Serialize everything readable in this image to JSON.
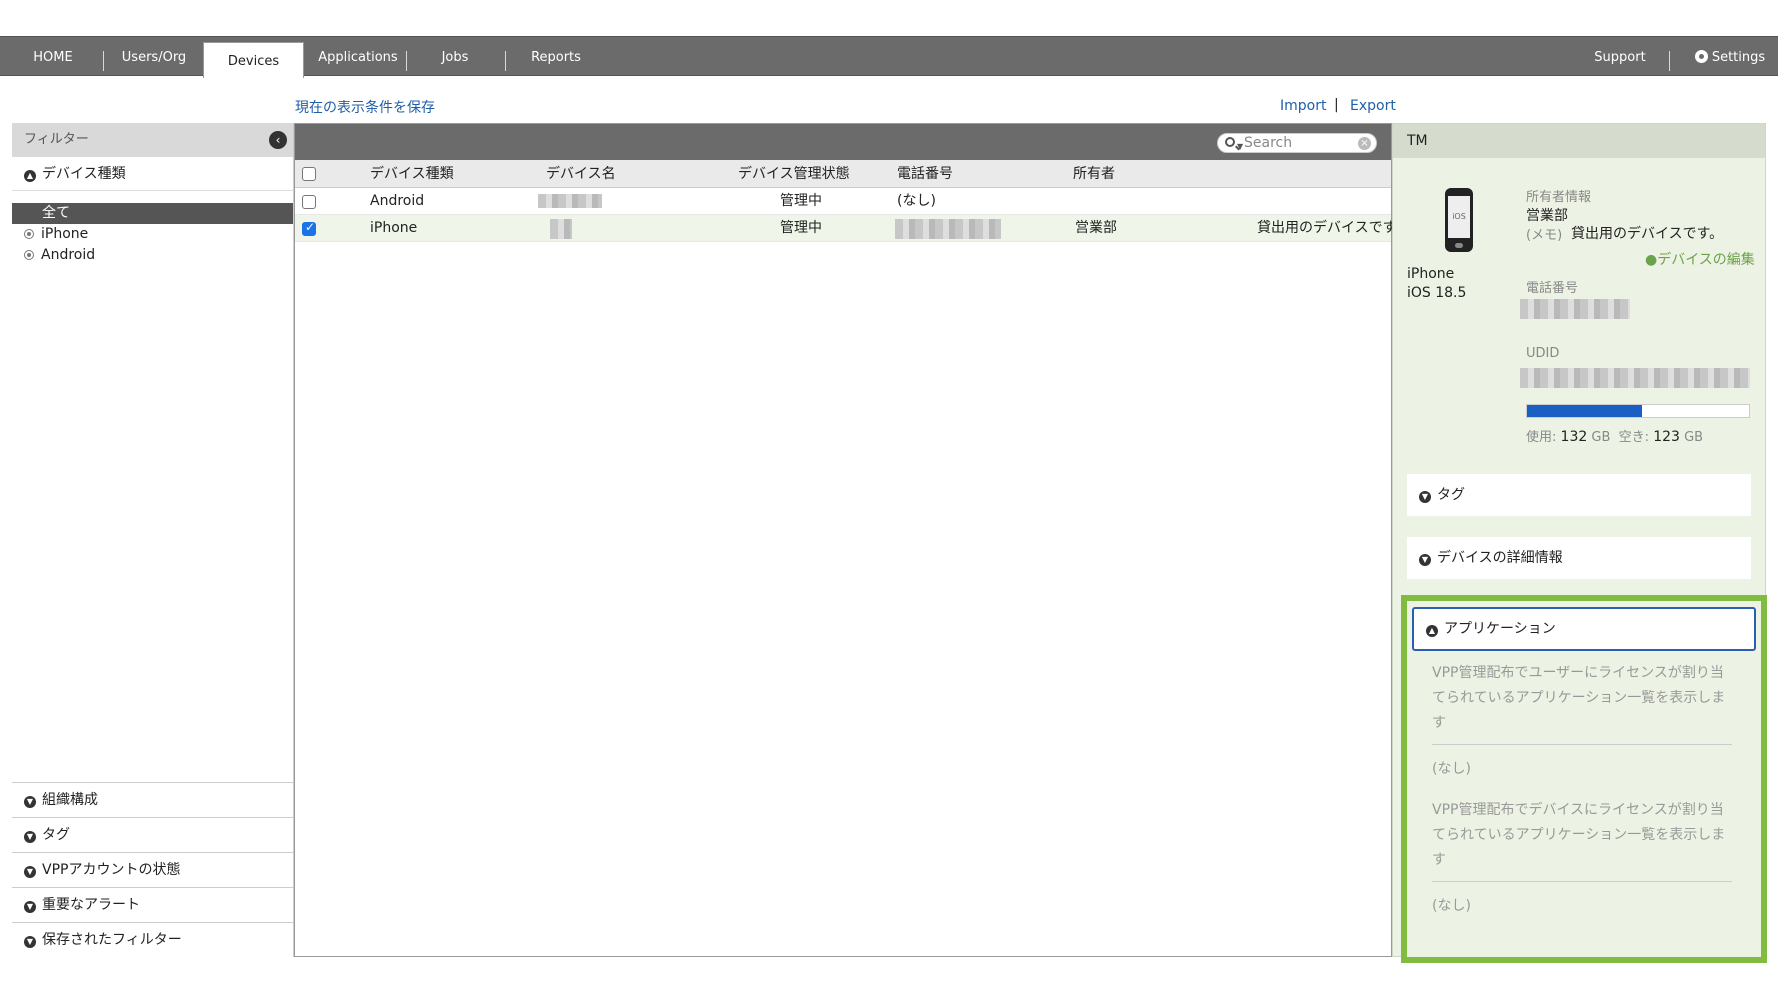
{
  "nav": {
    "items": [
      "HOME",
      "Users/Org",
      "Devices",
      "Applications",
      "Jobs",
      "Reports"
    ],
    "support": "Support",
    "settings": "Settings"
  },
  "links": {
    "save_view": "現在の表示条件を保存",
    "import": "Import",
    "separator": "|",
    "export": "Export"
  },
  "sidebar": {
    "header": "フィルター",
    "device_type_title": "デバイス種類",
    "options": [
      "全て",
      "iPhone",
      "Android"
    ],
    "bottom_sections": [
      "組織構成",
      "タグ",
      "VPPアカウントの状態",
      "重要なアラート",
      "保存されたフィルター"
    ]
  },
  "table": {
    "search_placeholder": "Search",
    "columns": [
      "デバイス種類",
      "デバイス名",
      "デバイス管理状態",
      "電話番号",
      "所有者"
    ],
    "rows": [
      {
        "type": "Android",
        "status": "管理中",
        "phone": "(なし)",
        "owner": "",
        "memo": "",
        "checked": false
      },
      {
        "type": "iPhone",
        "status": "管理中",
        "phone": "",
        "owner": "営業部",
        "memo": "貸出用のデバイスです",
        "checked": true
      }
    ]
  },
  "detail": {
    "header": "TM",
    "device_model": "iPhone",
    "os_version": "iOS 18.5",
    "owner_label": "所有者情報",
    "owner_value": "営業部",
    "memo_label": "(メモ)",
    "memo_value": "貸出用のデバイスです。",
    "edit_link": "デバイスの編集",
    "phone_label": "電話番号",
    "udid_label": "UDID",
    "storage": {
      "used_fraction": 0.52,
      "used_label": "使用:",
      "used_value": "132",
      "free_label": "空き:",
      "free_value": "123",
      "unit": "GB"
    },
    "sections": [
      "タグ",
      "デバイスの詳細情報",
      "アプリケーション"
    ],
    "app_section": {
      "user_vpp_text": "VPP管理配布でユーザーにライセンスが割り当てられているアプリケーション一覧を表示します",
      "user_vpp_value": "(なし)",
      "device_vpp_text": "VPP管理配布でデバイスにライセンスが割り当てられているアプリケーション一覧を表示します",
      "device_vpp_value": "(なし)"
    },
    "highlight_color": "#7fbc3f"
  }
}
